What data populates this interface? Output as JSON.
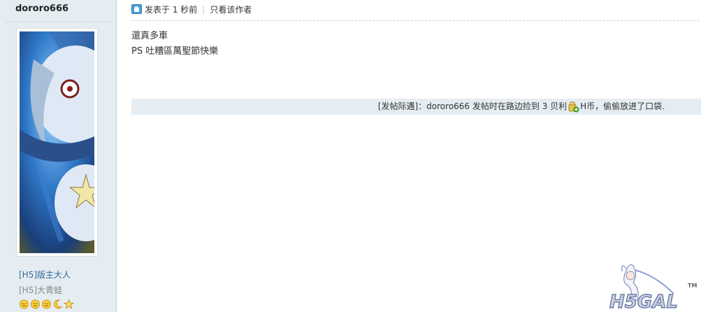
{
  "user": {
    "username": "dororo666",
    "group_admin": "[H5]版主大人",
    "group_user": "[H5]大青蛙",
    "level_icons": [
      "sun-icon",
      "sun-icon",
      "sun-icon",
      "moon-icon",
      "star-icon"
    ]
  },
  "post": {
    "posted_label": "发表于 1 秒前",
    "author_only": "只看该作者",
    "content_lines": [
      "還真多車",
      "PS 吐糟區萬聖節快樂"
    ],
    "luck": {
      "prefix": "[发帖际遇]：dororo666 发帖时在路边捡到 3 贝利",
      "suffix": "H币，偷偷放进了口袋."
    }
  },
  "watermark": {
    "logo_text": "H5GAL",
    "tm": "TM"
  },
  "colors": {
    "sidebar_bg": "#e5edf2",
    "link_blue": "#336699",
    "luck_bar_bg": "#e5edf2"
  }
}
